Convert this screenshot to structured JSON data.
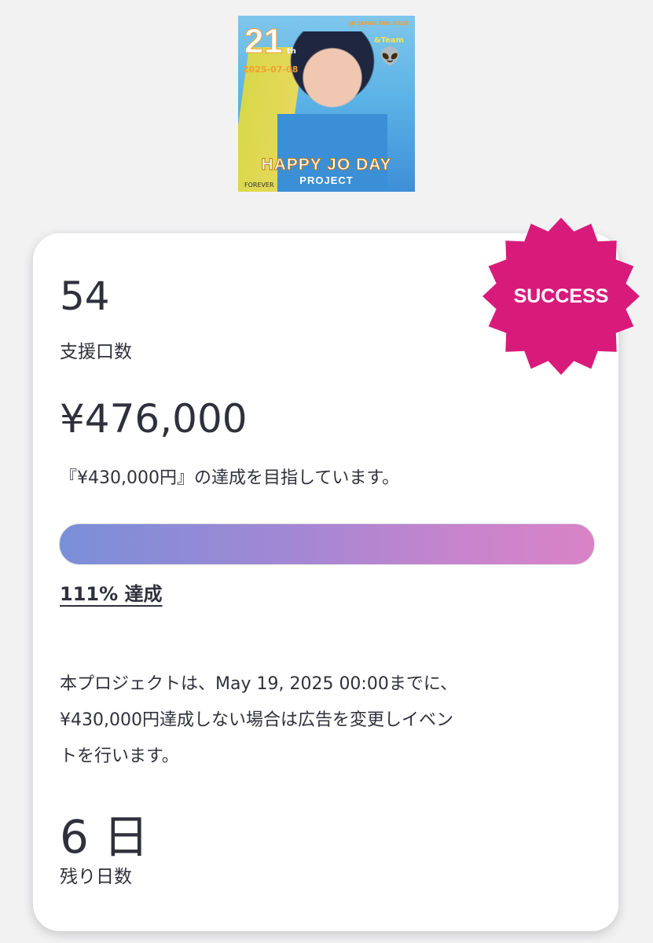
{
  "header_image": {
    "number": "21",
    "suffix": "th",
    "date": "2025-07-08",
    "fanbase": "JO JAPAN FAN BASE",
    "group": "&Team",
    "title": "HAPPY JO DAY",
    "subtitle": "PROJECT",
    "signature": "FOREVER"
  },
  "badge": {
    "label": "SUCCESS",
    "color": "#d81b7b"
  },
  "stats": {
    "supporters_value": "54",
    "supporters_label": "支援口数",
    "amount_value": "¥476,000",
    "goal_text": "『¥430,000円』の達成を目指しています。",
    "progress_percent": 111,
    "progress_label": "111% 達成",
    "notice_line1": "本プロジェクトは、May 19, 2025 00:00までに、",
    "notice_line2": "¥430,000円達成しない場合は広告を変更しイベン",
    "notice_line3": "トを行います。",
    "days_value": "6 日",
    "days_label": "残り日数"
  },
  "colors": {
    "progress_start": "#7a8fd8",
    "progress_end": "#d983c6",
    "text": "#30303c"
  }
}
